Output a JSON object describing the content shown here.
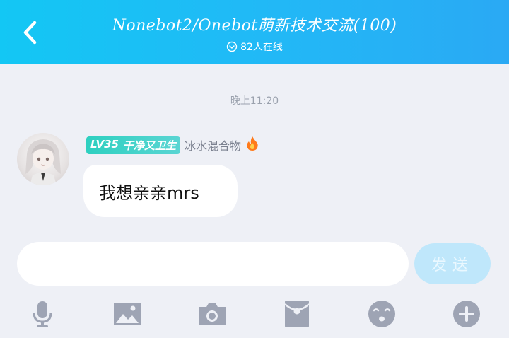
{
  "header": {
    "title": "Nonebot2/Onebot萌新技术交流(100)",
    "online": "82人在线"
  },
  "chat": {
    "timestamp": "晚上11:20",
    "message": {
      "level": "LV35",
      "title_tag": "干净又卫生",
      "sender": "冰水混合物",
      "text": "我想亲亲mrs"
    }
  },
  "composer": {
    "input_value": "",
    "send_label": "发送"
  },
  "toolbar": {
    "icons": [
      "microphone-icon",
      "image-icon",
      "camera-icon",
      "red-packet-icon",
      "emoji-icon",
      "plus-icon"
    ]
  },
  "colors": {
    "header_start": "#13c7f4",
    "header_end": "#2aa9f4",
    "background": "#eef0f6",
    "level_badge": "#2ed0c0",
    "send_disabled": "#bfe7fb",
    "icon_gray": "#9ea4b4"
  }
}
